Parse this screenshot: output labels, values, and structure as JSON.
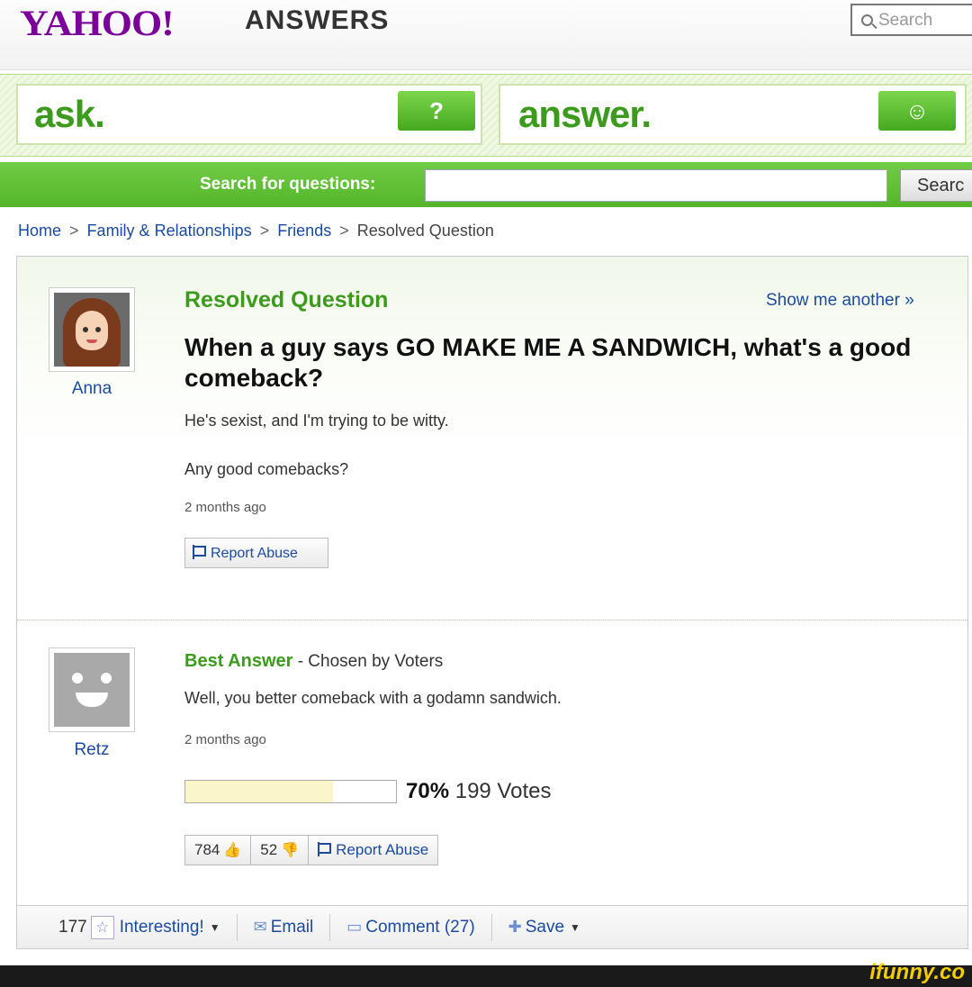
{
  "header": {
    "logo": "YAHOO!",
    "logo_sub": "ANSWERS",
    "search_placeholder": "Search"
  },
  "action_bar": {
    "ask_label": "ask.",
    "ask_icon": "?",
    "answer_label": "answer.",
    "answer_icon": "☺"
  },
  "search_bar": {
    "label": "Search for questions:",
    "button": "Searc"
  },
  "breadcrumb": {
    "home": "Home",
    "family": "Family & Relationships",
    "friends": "Friends",
    "current": "Resolved Question",
    "separator": ">"
  },
  "question": {
    "status": "Resolved Question",
    "show_another": "Show me another »",
    "asker": "Anna",
    "title": "When a guy says GO MAKE ME A SANDWICH, what's a good comeback?",
    "body_1": "He's sexist, and I'm trying to be witty.",
    "body_2": "Any good comebacks?",
    "time": "2 months ago",
    "report": "Report Abuse"
  },
  "best_answer": {
    "label": "Best Answer",
    "chosen_by": " - Chosen by Voters",
    "answerer": "Retz",
    "text": "Well, you better comeback with a godamn sandwich.",
    "time": "2 months ago",
    "vote_percent": "70%",
    "vote_fraction": 0.7,
    "votes": "199 Votes",
    "thumbs_up": "784",
    "thumbs_down": "52",
    "report": "Report Abuse"
  },
  "bottom_bar": {
    "interesting_count": "177",
    "interesting": "Interesting!",
    "email": "Email",
    "comment": "Comment (27)",
    "save": "Save"
  },
  "watermark": "ifunny.co",
  "colors": {
    "brand_purple": "#7b0099",
    "answers_green": "#3c9a1c",
    "link_blue": "#1a4b9f"
  }
}
